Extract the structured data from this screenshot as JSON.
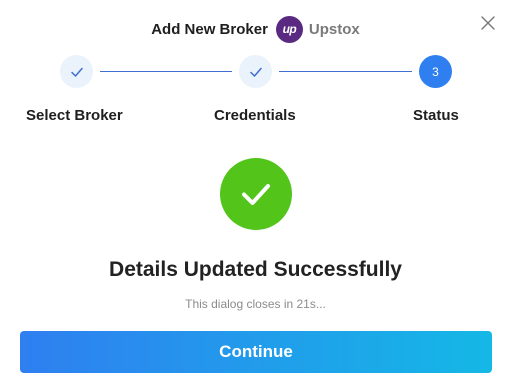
{
  "header": {
    "title": "Add New Broker",
    "broker_logo_text": "up",
    "broker_name": "Upstox",
    "broker_logo_color": "#5a2a82"
  },
  "steps": [
    {
      "label": "Select Broker",
      "state": "completed",
      "icon": "check-icon"
    },
    {
      "label": "Credentials",
      "state": "completed",
      "icon": "check-icon"
    },
    {
      "label": "Status",
      "state": "active",
      "number": "3"
    }
  ],
  "status": {
    "icon": "check-circle-icon",
    "headline": "Details Updated Successfully",
    "countdown_text": "This dialog closes in 21s..."
  },
  "actions": {
    "continue_label": "Continue"
  },
  "colors": {
    "accent": "#2f7ff0",
    "success": "#52c41a",
    "button_gradient_end": "#14b8e6"
  }
}
